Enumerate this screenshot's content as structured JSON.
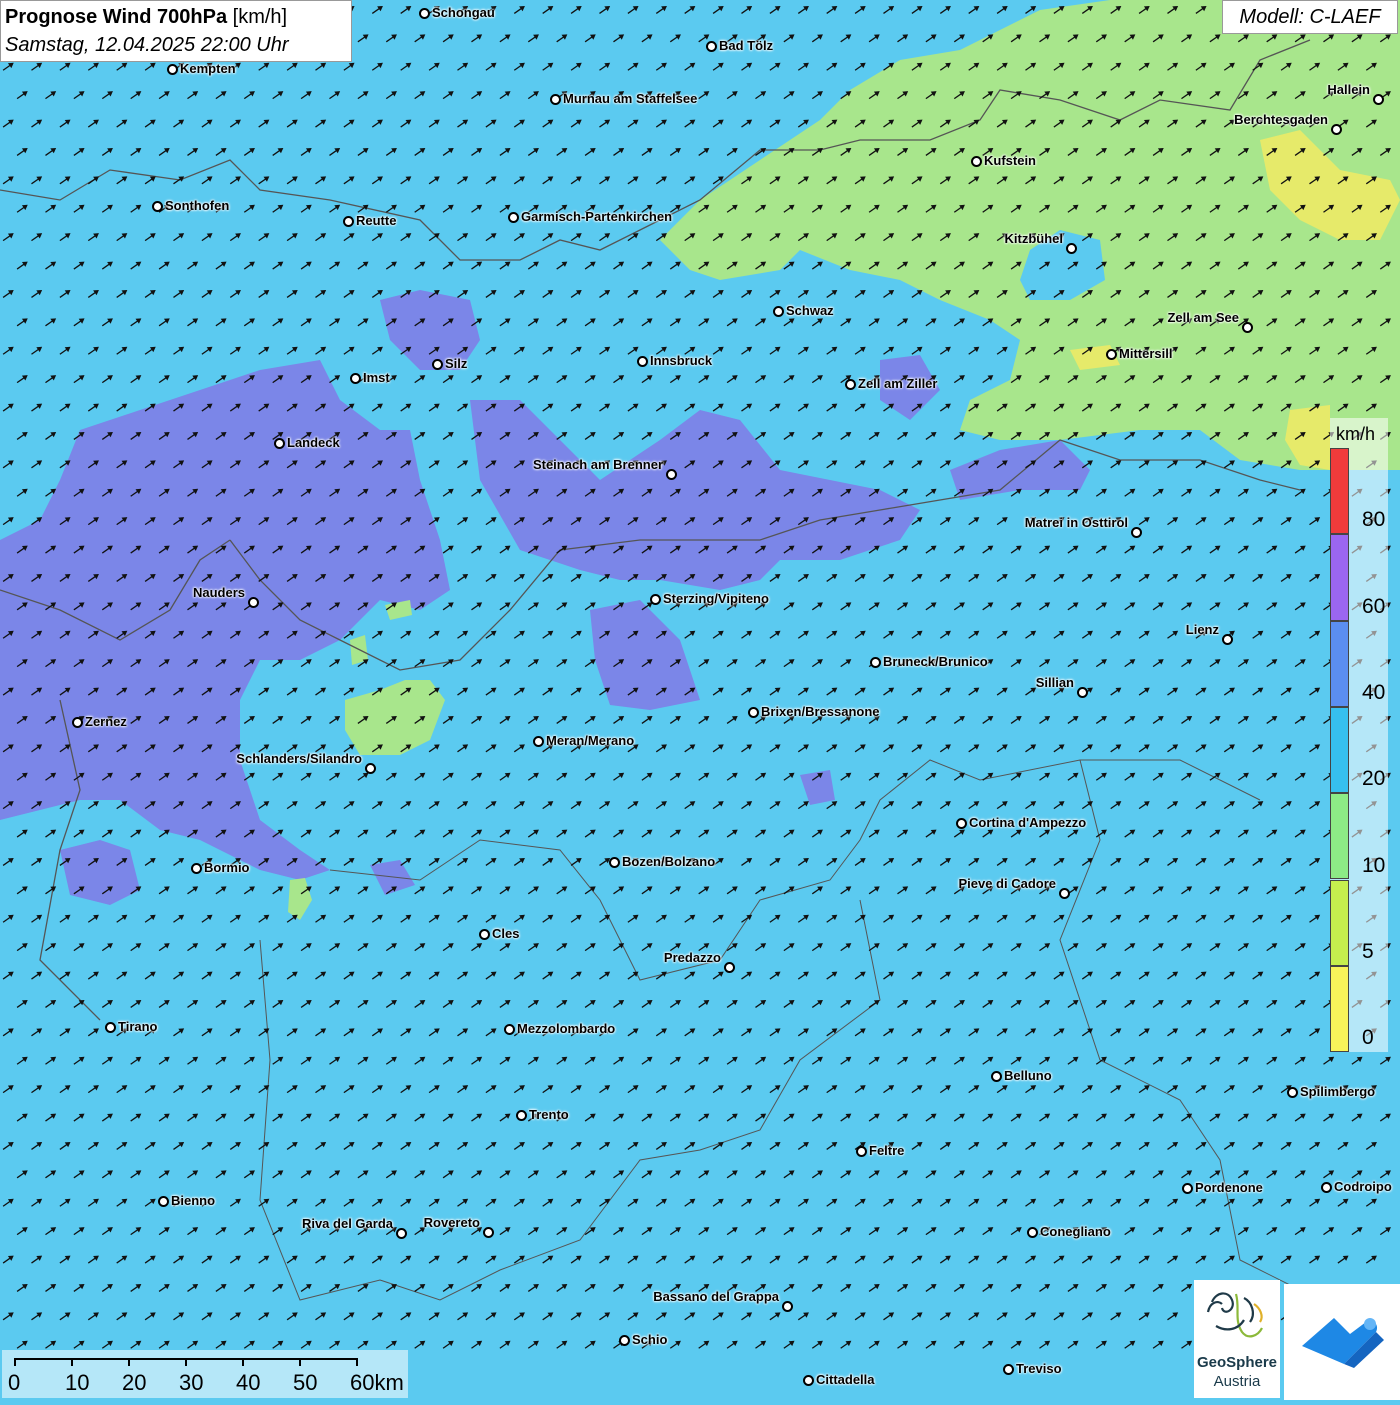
{
  "header": {
    "title_bold": "Prognose Wind 700hPa",
    "title_unit": "[km/h]",
    "subtitle": "Samstag, 12.04.2025 22:00 Uhr"
  },
  "model_label": "Modell: C-LAEF",
  "legend": {
    "unit": "km/h",
    "classes": [
      {
        "label": "0",
        "color": "#f8f35a"
      },
      {
        "label": "5",
        "color": "#c6ef4e"
      },
      {
        "label": "10",
        "color": "#8deb86"
      },
      {
        "label": "20",
        "color": "#36c0ef"
      },
      {
        "label": "40",
        "color": "#5b8ef0"
      },
      {
        "label": "60",
        "color": "#9b66f0"
      },
      {
        "label": "80",
        "color": "#f03b3b"
      }
    ]
  },
  "scale_bar": {
    "labels": [
      "0",
      "10",
      "20",
      "30",
      "40",
      "50",
      "60km"
    ]
  },
  "logos": {
    "geosphere_name": "GeoSphere",
    "geosphere_country": "Austria"
  },
  "colors": {
    "background_wind": "#5bcaf0",
    "zone_purple": "#7b86e8",
    "zone_green": "#a8e68c",
    "zone_yellow": "#e6ea6a"
  },
  "cities": [
    {
      "name": "Schongau"
    },
    {
      "name": "Bad Tölz"
    },
    {
      "name": "Kempten"
    },
    {
      "name": "Murnau am Staffelsee"
    },
    {
      "name": "Hallein"
    },
    {
      "name": "Berchtesgaden"
    },
    {
      "name": "Kufstein"
    },
    {
      "name": "Sonthofen"
    },
    {
      "name": "Reutte"
    },
    {
      "name": "Garmisch-Partenkirchen"
    },
    {
      "name": "Kitzbühel"
    },
    {
      "name": "Schwaz"
    },
    {
      "name": "Zell am See"
    },
    {
      "name": "Mittersill"
    },
    {
      "name": "Silz"
    },
    {
      "name": "Innsbruck"
    },
    {
      "name": "Imst"
    },
    {
      "name": "Zell am Ziller"
    },
    {
      "name": "Landeck"
    },
    {
      "name": "Steinach am Brenner"
    },
    {
      "name": "Matrei in Osttirol"
    },
    {
      "name": "Nauders"
    },
    {
      "name": "Sterzing/Vipiteno"
    },
    {
      "name": "Lienz"
    },
    {
      "name": "Bruneck/Brunico"
    },
    {
      "name": "Sillian"
    },
    {
      "name": "Zernez"
    },
    {
      "name": "Brixen/Bressanone"
    },
    {
      "name": "Meran/Merano"
    },
    {
      "name": "Schlanders/Silandro"
    },
    {
      "name": "Cortina d'Ampezzo"
    },
    {
      "name": "Bozen/Bolzano"
    },
    {
      "name": "Bormio"
    },
    {
      "name": "Pieve di Cadore"
    },
    {
      "name": "Cles"
    },
    {
      "name": "Predazzo"
    },
    {
      "name": "Tirano"
    },
    {
      "name": "Mezzolombardo"
    },
    {
      "name": "Belluno"
    },
    {
      "name": "Spilimbergo"
    },
    {
      "name": "Trento"
    },
    {
      "name": "Feltre"
    },
    {
      "name": "Pordenone"
    },
    {
      "name": "Codroipo"
    },
    {
      "name": "Bienno"
    },
    {
      "name": "Riva del Garda"
    },
    {
      "name": "Rovereto"
    },
    {
      "name": "Conegliano"
    },
    {
      "name": "Bassano del Grappa"
    },
    {
      "name": "Schio"
    },
    {
      "name": "Treviso"
    },
    {
      "name": "Cittadella"
    }
  ]
}
